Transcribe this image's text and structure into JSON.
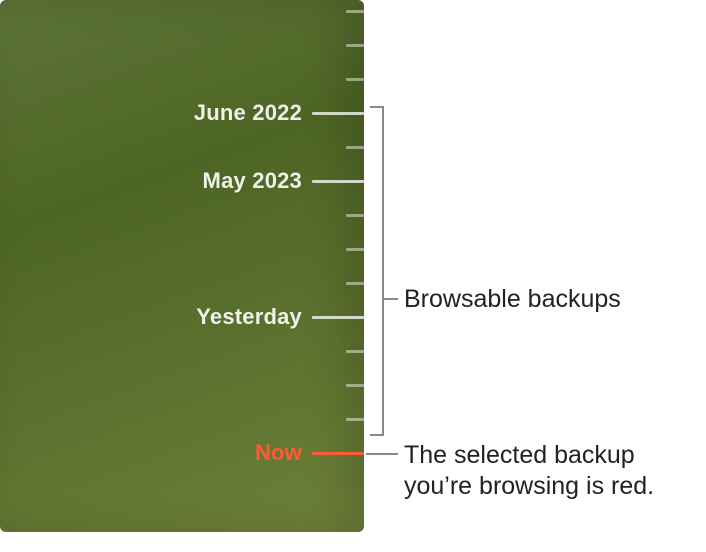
{
  "timeline": {
    "labels": {
      "june2022": "June 2022",
      "may2023": "May 2023",
      "yesterday": "Yesterday",
      "now": "Now"
    }
  },
  "annotations": {
    "browsable": "Browsable backups",
    "selected": "The selected backup you’re browsing is red."
  }
}
